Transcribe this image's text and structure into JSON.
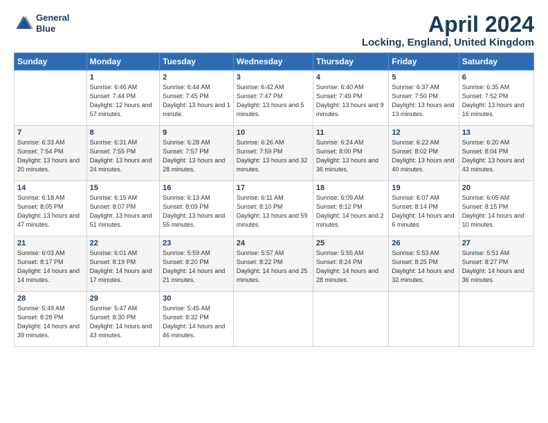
{
  "logo": {
    "line1": "General",
    "line2": "Blue"
  },
  "title": "April 2024",
  "subtitle": "Locking, England, United Kingdom",
  "weekdays": [
    "Sunday",
    "Monday",
    "Tuesday",
    "Wednesday",
    "Thursday",
    "Friday",
    "Saturday"
  ],
  "weeks": [
    [
      {
        "day": "",
        "sunrise": "",
        "sunset": "",
        "daylight": ""
      },
      {
        "day": "1",
        "sunrise": "Sunrise: 6:46 AM",
        "sunset": "Sunset: 7:44 PM",
        "daylight": "Daylight: 12 hours and 57 minutes."
      },
      {
        "day": "2",
        "sunrise": "Sunrise: 6:44 AM",
        "sunset": "Sunset: 7:45 PM",
        "daylight": "Daylight: 13 hours and 1 minute."
      },
      {
        "day": "3",
        "sunrise": "Sunrise: 6:42 AM",
        "sunset": "Sunset: 7:47 PM",
        "daylight": "Daylight: 13 hours and 5 minutes."
      },
      {
        "day": "4",
        "sunrise": "Sunrise: 6:40 AM",
        "sunset": "Sunset: 7:49 PM",
        "daylight": "Daylight: 13 hours and 9 minutes."
      },
      {
        "day": "5",
        "sunrise": "Sunrise: 6:37 AM",
        "sunset": "Sunset: 7:50 PM",
        "daylight": "Daylight: 13 hours and 13 minutes."
      },
      {
        "day": "6",
        "sunrise": "Sunrise: 6:35 AM",
        "sunset": "Sunset: 7:52 PM",
        "daylight": "Daylight: 13 hours and 16 minutes."
      }
    ],
    [
      {
        "day": "7",
        "sunrise": "Sunrise: 6:33 AM",
        "sunset": "Sunset: 7:54 PM",
        "daylight": "Daylight: 13 hours and 20 minutes."
      },
      {
        "day": "8",
        "sunrise": "Sunrise: 6:31 AM",
        "sunset": "Sunset: 7:55 PM",
        "daylight": "Daylight: 13 hours and 24 minutes."
      },
      {
        "day": "9",
        "sunrise": "Sunrise: 6:28 AM",
        "sunset": "Sunset: 7:57 PM",
        "daylight": "Daylight: 13 hours and 28 minutes."
      },
      {
        "day": "10",
        "sunrise": "Sunrise: 6:26 AM",
        "sunset": "Sunset: 7:59 PM",
        "daylight": "Daylight: 13 hours and 32 minutes."
      },
      {
        "day": "11",
        "sunrise": "Sunrise: 6:24 AM",
        "sunset": "Sunset: 8:00 PM",
        "daylight": "Daylight: 13 hours and 36 minutes."
      },
      {
        "day": "12",
        "sunrise": "Sunrise: 6:22 AM",
        "sunset": "Sunset: 8:02 PM",
        "daylight": "Daylight: 13 hours and 40 minutes."
      },
      {
        "day": "13",
        "sunrise": "Sunrise: 6:20 AM",
        "sunset": "Sunset: 8:04 PM",
        "daylight": "Daylight: 13 hours and 43 minutes."
      }
    ],
    [
      {
        "day": "14",
        "sunrise": "Sunrise: 6:18 AM",
        "sunset": "Sunset: 8:05 PM",
        "daylight": "Daylight: 13 hours and 47 minutes."
      },
      {
        "day": "15",
        "sunrise": "Sunrise: 6:15 AM",
        "sunset": "Sunset: 8:07 PM",
        "daylight": "Daylight: 13 hours and 51 minutes."
      },
      {
        "day": "16",
        "sunrise": "Sunrise: 6:13 AM",
        "sunset": "Sunset: 8:09 PM",
        "daylight": "Daylight: 13 hours and 55 minutes."
      },
      {
        "day": "17",
        "sunrise": "Sunrise: 6:11 AM",
        "sunset": "Sunset: 8:10 PM",
        "daylight": "Daylight: 13 hours and 59 minutes."
      },
      {
        "day": "18",
        "sunrise": "Sunrise: 6:09 AM",
        "sunset": "Sunset: 8:12 PM",
        "daylight": "Daylight: 14 hours and 2 minutes."
      },
      {
        "day": "19",
        "sunrise": "Sunrise: 6:07 AM",
        "sunset": "Sunset: 8:14 PM",
        "daylight": "Daylight: 14 hours and 6 minutes."
      },
      {
        "day": "20",
        "sunrise": "Sunrise: 6:05 AM",
        "sunset": "Sunset: 8:15 PM",
        "daylight": "Daylight: 14 hours and 10 minutes."
      }
    ],
    [
      {
        "day": "21",
        "sunrise": "Sunrise: 6:03 AM",
        "sunset": "Sunset: 8:17 PM",
        "daylight": "Daylight: 14 hours and 14 minutes."
      },
      {
        "day": "22",
        "sunrise": "Sunrise: 6:01 AM",
        "sunset": "Sunset: 8:19 PM",
        "daylight": "Daylight: 14 hours and 17 minutes."
      },
      {
        "day": "23",
        "sunrise": "Sunrise: 5:59 AM",
        "sunset": "Sunset: 8:20 PM",
        "daylight": "Daylight: 14 hours and 21 minutes."
      },
      {
        "day": "24",
        "sunrise": "Sunrise: 5:57 AM",
        "sunset": "Sunset: 8:22 PM",
        "daylight": "Daylight: 14 hours and 25 minutes."
      },
      {
        "day": "25",
        "sunrise": "Sunrise: 5:55 AM",
        "sunset": "Sunset: 8:24 PM",
        "daylight": "Daylight: 14 hours and 28 minutes."
      },
      {
        "day": "26",
        "sunrise": "Sunrise: 5:53 AM",
        "sunset": "Sunset: 8:25 PM",
        "daylight": "Daylight: 14 hours and 32 minutes."
      },
      {
        "day": "27",
        "sunrise": "Sunrise: 5:51 AM",
        "sunset": "Sunset: 8:27 PM",
        "daylight": "Daylight: 14 hours and 36 minutes."
      }
    ],
    [
      {
        "day": "28",
        "sunrise": "Sunrise: 5:49 AM",
        "sunset": "Sunset: 8:28 PM",
        "daylight": "Daylight: 14 hours and 39 minutes."
      },
      {
        "day": "29",
        "sunrise": "Sunrise: 5:47 AM",
        "sunset": "Sunset: 8:30 PM",
        "daylight": "Daylight: 14 hours and 43 minutes."
      },
      {
        "day": "30",
        "sunrise": "Sunrise: 5:45 AM",
        "sunset": "Sunset: 8:32 PM",
        "daylight": "Daylight: 14 hours and 46 minutes."
      },
      {
        "day": "",
        "sunrise": "",
        "sunset": "",
        "daylight": ""
      },
      {
        "day": "",
        "sunrise": "",
        "sunset": "",
        "daylight": ""
      },
      {
        "day": "",
        "sunrise": "",
        "sunset": "",
        "daylight": ""
      },
      {
        "day": "",
        "sunrise": "",
        "sunset": "",
        "daylight": ""
      }
    ]
  ]
}
